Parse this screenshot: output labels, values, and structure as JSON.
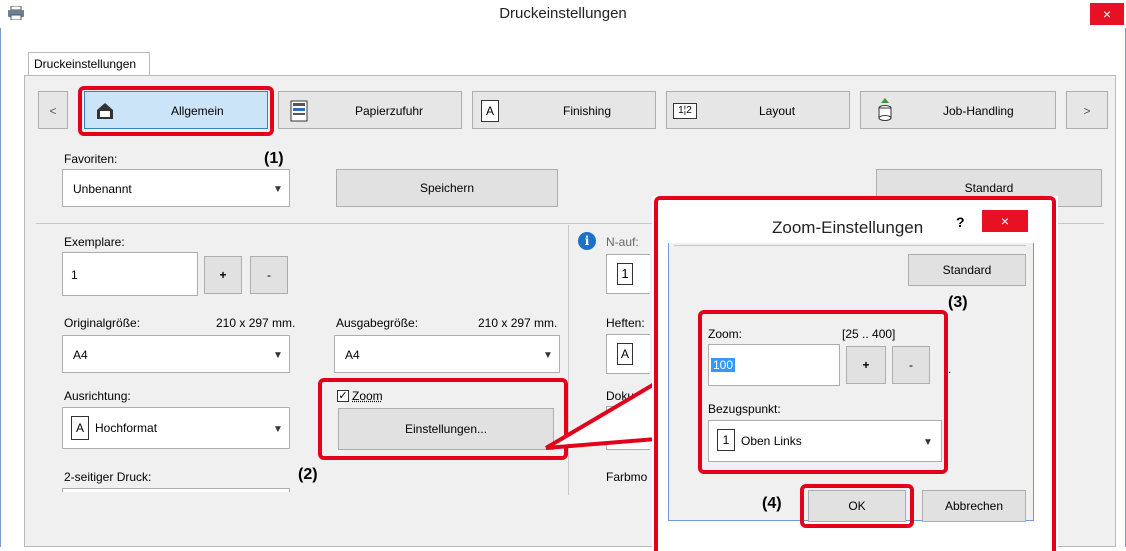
{
  "window": {
    "title": "Druckeinstellungen",
    "close": "×"
  },
  "tab_label": "Druckeinstellungen",
  "nav": {
    "prev": "<",
    "next": ">",
    "items": [
      "Allgemein",
      "Papierzufuhr",
      "Finishing",
      "Layout",
      "Job-Handling"
    ]
  },
  "favorites": {
    "label": "Favoriten:",
    "value": "Unbenannt",
    "save": "Speichern",
    "standard": "Standard"
  },
  "copies": {
    "label": "Exemplare:",
    "value": "1",
    "plus": "+",
    "minus": "-"
  },
  "original_size": {
    "label": "Originalgröße:",
    "dims": "210 x 297 mm.",
    "value": "A4"
  },
  "output_size": {
    "label": "Ausgabegröße:",
    "dims": "210 x 297 mm.",
    "value": "A4"
  },
  "orientation": {
    "label": "Ausrichtung:",
    "value": "Hochformat",
    "icon_letter": "A"
  },
  "zoom": {
    "checkbox_label": "Zoom",
    "settings_button": "Einstellungen..."
  },
  "duplex": {
    "label": "2-seitiger Druck:"
  },
  "right_column": {
    "nup": "N-auf:",
    "nup_icon": "1",
    "staple": "Heften:",
    "staple_icon": "A",
    "doc": "Doku",
    "color": "Farbmo"
  },
  "zoom_dialog": {
    "title": "Zoom-Einstellungen",
    "help": "?",
    "close": "×",
    "standard": "Standard",
    "zoom_label": "Zoom:",
    "zoom_range": "[25 .. 400]",
    "zoom_value": "100",
    "plus": "+",
    "minus": "-",
    "ref_label": "Bezugspunkt:",
    "ref_value": "Oben Links",
    "ref_icon": "1",
    "ok": "OK",
    "cancel": "Abbrechen",
    "trailing_dot": "."
  },
  "callouts": [
    "(1)",
    "(2)",
    "(3)",
    "(4)"
  ],
  "colors": {
    "highlight": "#e2001a",
    "selected_nav": "#cce4f7",
    "dialog_border": "#6f9ad8",
    "close_red": "#e81123"
  }
}
